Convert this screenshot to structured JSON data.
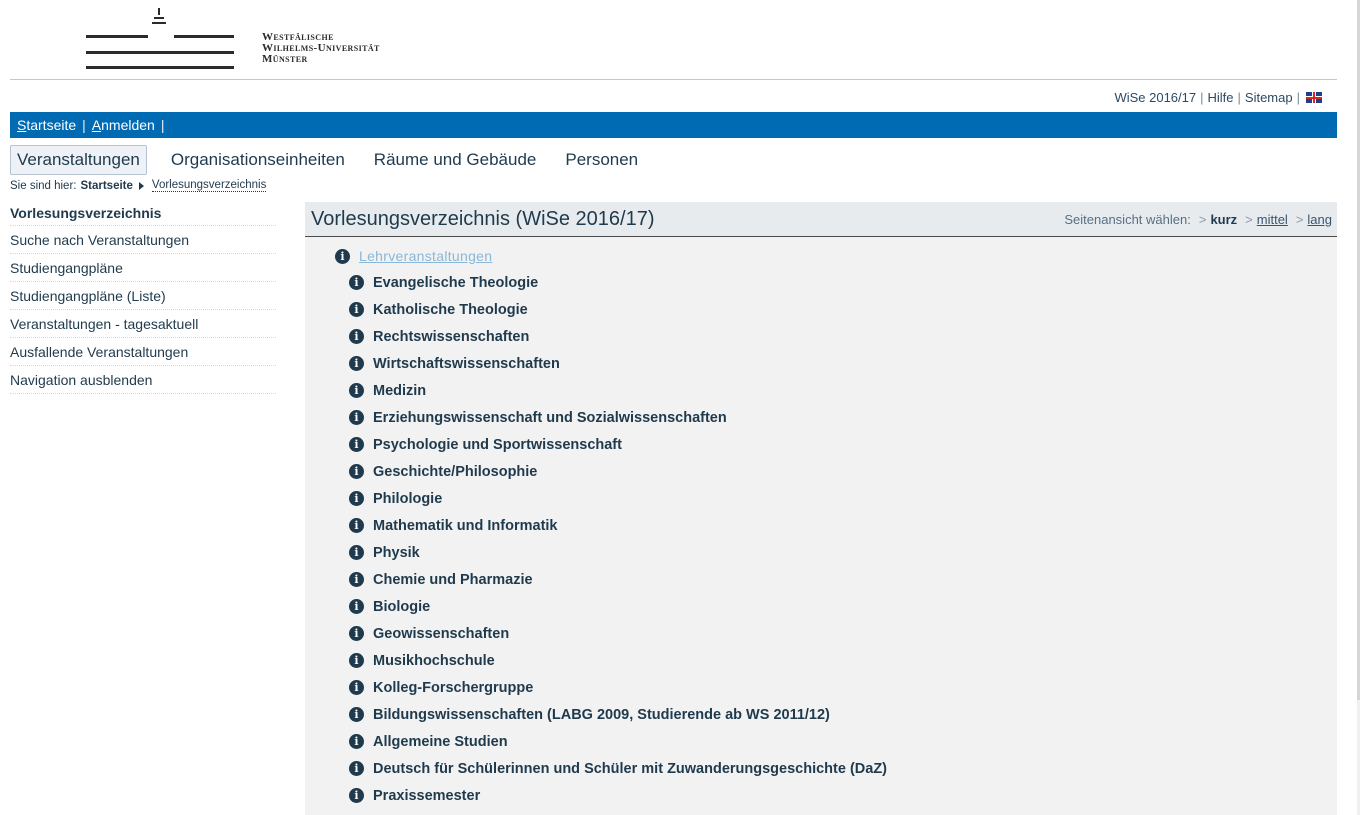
{
  "logo": {
    "line1": "Westfälische",
    "line2": "Wilhelms-Universität",
    "line3": "Münster"
  },
  "util": {
    "semester": "WiSe 2016/17",
    "help": "Hilfe",
    "sitemap": "Sitemap",
    "separator": "|",
    "language_icon": "uk-flag-icon"
  },
  "bluebar": {
    "home_first": "S",
    "home_rest": "tartseite",
    "login_first": "A",
    "login_rest": "nmelden",
    "separator": "|"
  },
  "tabs": [
    {
      "label": "Veranstaltungen",
      "active": true
    },
    {
      "label": "Organisationseinheiten"
    },
    {
      "label": "Räume und Gebäude"
    },
    {
      "label": "Personen"
    }
  ],
  "breadcrumb": {
    "prefix": "Sie sind hier:",
    "home": "Startseite",
    "current": "Vorlesungsverzeichnis"
  },
  "sidebar": {
    "items": [
      {
        "label": "Vorlesungsverzeichnis",
        "current": true
      },
      {
        "label": "Suche nach Veranstaltungen"
      },
      {
        "label": "Studiengangpläne"
      },
      {
        "label": "Studiengangpläne (Liste)"
      },
      {
        "label": "Veranstaltungen - tagesaktuell"
      },
      {
        "label": "Ausfallende Veranstaltungen"
      },
      {
        "label": "Navigation ausblenden"
      }
    ]
  },
  "content": {
    "title": "Vorlesungsverzeichnis (WiSe 2016/17)",
    "view_label": "Seitenansicht wählen:",
    "view_kurz": "kurz",
    "view_mittel": "mittel",
    "view_lang": "lang",
    "root": "Lehrveranstaltungen",
    "items": [
      "Evangelische Theologie",
      "Katholische Theologie",
      "Rechtswissenschaften",
      "Wirtschaftswissenschaften",
      "Medizin",
      "Erziehungswissenschaft und Sozialwissenschaften",
      "Psychologie und Sportwissenschaft",
      "Geschichte/Philosophie",
      "Philologie",
      "Mathematik und Informatik",
      "Physik",
      "Chemie und Pharmazie",
      "Biologie",
      "Geowissenschaften",
      "Musikhochschule",
      "Kolleg-Forschergruppe",
      "Bildungswissenschaften (LABG 2009, Studierende ab WS 2011/12)",
      "Allgemeine Studien",
      "Deutsch für Schülerinnen und Schüler mit Zuwanderungsgeschichte (DaZ)",
      "Praxissemester"
    ]
  },
  "colors": {
    "brand_blue": "#006ab3",
    "text_dark": "#1f3a4d",
    "link_light": "#8ab7d8"
  }
}
